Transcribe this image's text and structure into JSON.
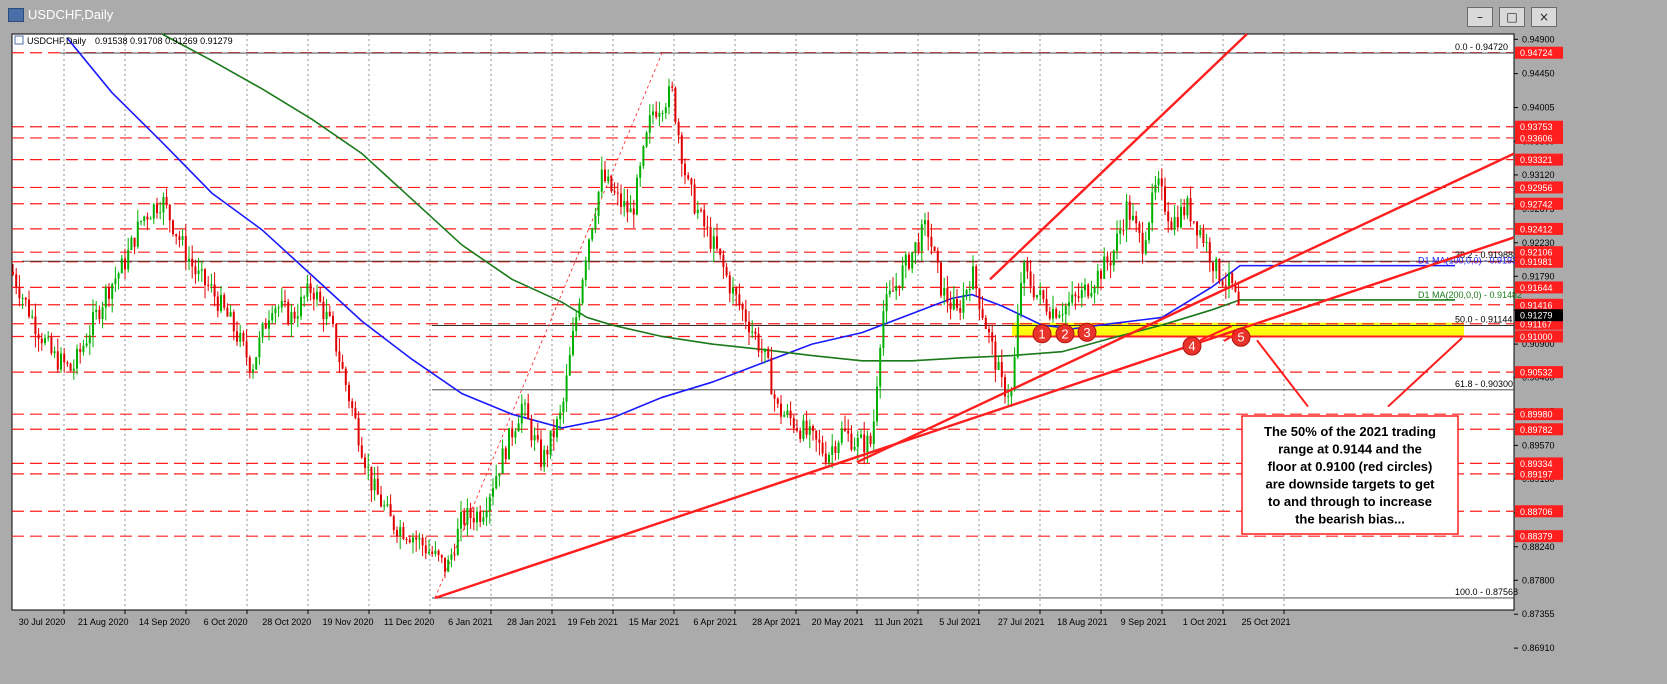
{
  "window": {
    "title": "USDCHF,Daily",
    "min_label": "–",
    "max_label": "□",
    "close_label": "×"
  },
  "chart_data": {
    "type": "candlestick",
    "symbol_label": "USDCHF,Daily",
    "ohlc_label": "0.91538 0.91708 0.91269 0.91279",
    "x_labels": [
      "30 Jul 2020",
      "21 Aug 2020",
      "14 Sep 2020",
      "6 Oct 2020",
      "28 Oct 2020",
      "19 Nov 2020",
      "11 Dec 2020",
      "6 Jan 2021",
      "28 Jan 2021",
      "19 Feb 2021",
      "15 Mar 2021",
      "6 Apr 2021",
      "28 Apr 2021",
      "20 May 2021",
      "11 Jun 2021",
      "5 Jul 2021",
      "27 Jul 2021",
      "18 Aug 2021",
      "9 Sep 2021",
      "1 Oct 2021",
      "25 Oct 2021"
    ],
    "y_ticks": [
      "0.94900",
      "0.94450",
      "0.94005",
      "0.93560",
      "0.93120",
      "0.92675",
      "0.92230",
      "0.91790",
      "0.91345",
      "0.90900",
      "0.90460",
      "0.90015",
      "0.89570",
      "0.89130",
      "0.88685",
      "0.88240",
      "0.87800",
      "0.87355",
      "0.86910"
    ],
    "ylim": [
      0.8741,
      0.9497
    ],
    "current_price": 0.91279,
    "level_tags": [
      {
        "value": 0.94724,
        "label": "0.94724"
      },
      {
        "value": 0.93753,
        "label": "0.93753"
      },
      {
        "value": 0.93606,
        "label": "0.93606"
      },
      {
        "value": 0.93321,
        "label": "0.93321"
      },
      {
        "value": 0.92956,
        "label": "0.92956"
      },
      {
        "value": 0.92742,
        "label": "0.92742"
      },
      {
        "value": 0.92412,
        "label": "0.92412"
      },
      {
        "value": 0.92106,
        "label": "0.92106"
      },
      {
        "value": 0.91981,
        "label": "0.91981"
      },
      {
        "value": 0.91644,
        "label": "0.91644"
      },
      {
        "value": 0.91416,
        "label": "0.91416"
      },
      {
        "value": 0.91167,
        "label": "0.91167"
      },
      {
        "value": 0.91,
        "label": "0.91000"
      },
      {
        "value": 0.90532,
        "label": "0.90532"
      },
      {
        "value": 0.8998,
        "label": "0.89980"
      },
      {
        "value": 0.89782,
        "label": "0.89782"
      },
      {
        "value": 0.89334,
        "label": "0.89334"
      },
      {
        "value": 0.89197,
        "label": "0.89197"
      },
      {
        "value": 0.88706,
        "label": "0.88706"
      },
      {
        "value": 0.88379,
        "label": "0.88379"
      }
    ],
    "fib_levels": [
      {
        "label": "0.0 - 0.94720",
        "value": 0.9472
      },
      {
        "label": "38.2 - 0.91988",
        "value": 0.91988
      },
      {
        "label": "50.0 - 0.91144",
        "value": 0.91144
      },
      {
        "label": "61.8 - 0.90300",
        "value": 0.903
      },
      {
        "label": "100.0 - 0.87568",
        "value": 0.87568
      }
    ],
    "ma_labels": [
      {
        "label": "D1 MA(100,0,0) - 0.91932",
        "value": 0.91932,
        "color": "#1a1aff"
      },
      {
        "label": "D1 MA(200,0,0) - 0.91482",
        "value": 0.91482,
        "color": "#1a7a1a"
      }
    ],
    "circle_labels": [
      "1",
      "2",
      "3",
      "4",
      "5"
    ],
    "annotation": [
      "The 50% of the 2021 trading",
      "range at 0.9144 and the",
      "floor at 0.9100 (red circles)",
      "are downside targets to get",
      "to and through to increase",
      "the bearish bias..."
    ],
    "colors": {
      "up": "#00b000",
      "down": "#e00000",
      "ma100": "#1a1aff",
      "ma200": "#1a7a1a",
      "level": "#ff1e1e",
      "fib": "#222222",
      "zone": "#ffff00",
      "trend": "#ff1e1e"
    },
    "close_path": [
      [
        0,
        0.9185
      ],
      [
        20,
        0.9125
      ],
      [
        40,
        0.9075
      ],
      [
        60,
        0.9055
      ],
      [
        75,
        0.91
      ],
      [
        95,
        0.916
      ],
      [
        112,
        0.9195
      ],
      [
        130,
        0.9255
      ],
      [
        150,
        0.928
      ],
      [
        165,
        0.9235
      ],
      [
        185,
        0.918
      ],
      [
        200,
        0.916
      ],
      [
        220,
        0.9115
      ],
      [
        240,
        0.906
      ],
      [
        260,
        0.9145
      ],
      [
        280,
        0.9125
      ],
      [
        300,
        0.9165
      ],
      [
        320,
        0.911
      ],
      [
        340,
        0.9005
      ],
      [
        360,
        0.8905
      ],
      [
        380,
        0.8855
      ],
      [
        400,
        0.884
      ],
      [
        420,
        0.8815
      ],
      [
        435,
        0.8795
      ],
      [
        450,
        0.886
      ],
      [
        470,
        0.887
      ],
      [
        490,
        0.894
      ],
      [
        510,
        0.901
      ],
      [
        530,
        0.8935
      ],
      [
        550,
        0.9
      ],
      [
        560,
        0.909
      ],
      [
        575,
        0.922
      ],
      [
        590,
        0.931
      ],
      [
        605,
        0.928
      ],
      [
        620,
        0.926
      ],
      [
        640,
        0.9395
      ],
      [
        660,
        0.942
      ],
      [
        675,
        0.93
      ],
      [
        690,
        0.925
      ],
      [
        705,
        0.921
      ],
      [
        720,
        0.916
      ],
      [
        740,
        0.911
      ],
      [
        755,
        0.9065
      ],
      [
        765,
        0.9005
      ],
      [
        780,
        0.899
      ],
      [
        800,
        0.8965
      ],
      [
        815,
        0.8945
      ],
      [
        830,
        0.8975
      ],
      [
        845,
        0.896
      ],
      [
        860,
        0.896
      ],
      [
        870,
        0.913
      ],
      [
        885,
        0.917
      ],
      [
        900,
        0.921
      ],
      [
        915,
        0.9245
      ],
      [
        930,
        0.916
      ],
      [
        945,
        0.913
      ],
      [
        960,
        0.9185
      ],
      [
        975,
        0.911
      ],
      [
        990,
        0.9035
      ],
      [
        1000,
        0.9025
      ],
      [
        1010,
        0.919
      ],
      [
        1025,
        0.9155
      ],
      [
        1040,
        0.9135
      ],
      [
        1055,
        0.914
      ],
      [
        1070,
        0.9155
      ],
      [
        1085,
        0.918
      ],
      [
        1100,
        0.9205
      ],
      [
        1115,
        0.927
      ],
      [
        1130,
        0.922
      ],
      [
        1145,
        0.93
      ],
      [
        1160,
        0.925
      ],
      [
        1175,
        0.927
      ],
      [
        1190,
        0.9235
      ],
      [
        1205,
        0.9185
      ],
      [
        1220,
        0.9165
      ],
      [
        1228,
        0.9128
      ]
    ],
    "ma100_path": [
      [
        55,
        0.9492
      ],
      [
        100,
        0.942
      ],
      [
        150,
        0.9355
      ],
      [
        200,
        0.9288
      ],
      [
        250,
        0.924
      ],
      [
        300,
        0.918
      ],
      [
        350,
        0.912
      ],
      [
        400,
        0.907
      ],
      [
        450,
        0.9025
      ],
      [
        500,
        0.8998
      ],
      [
        550,
        0.898
      ],
      [
        600,
        0.8993
      ],
      [
        650,
        0.902
      ],
      [
        700,
        0.904
      ],
      [
        750,
        0.9065
      ],
      [
        800,
        0.909
      ],
      [
        850,
        0.9105
      ],
      [
        900,
        0.913
      ],
      [
        940,
        0.915
      ],
      [
        960,
        0.9155
      ],
      [
        990,
        0.914
      ],
      [
        1030,
        0.9115
      ],
      [
        1060,
        0.911
      ],
      [
        1100,
        0.9117
      ],
      [
        1150,
        0.9125
      ],
      [
        1200,
        0.9165
      ],
      [
        1228,
        0.9193
      ],
      [
        1443,
        0.9193
      ]
    ],
    "ma200_path": [
      [
        150,
        0.9497
      ],
      [
        200,
        0.9462
      ],
      [
        250,
        0.9425
      ],
      [
        300,
        0.9385
      ],
      [
        350,
        0.934
      ],
      [
        400,
        0.928
      ],
      [
        450,
        0.922
      ],
      [
        500,
        0.9175
      ],
      [
        550,
        0.9145
      ],
      [
        575,
        0.9125
      ],
      [
        600,
        0.9115
      ],
      [
        650,
        0.91
      ],
      [
        700,
        0.909
      ],
      [
        750,
        0.9083
      ],
      [
        800,
        0.9075
      ],
      [
        850,
        0.9068
      ],
      [
        900,
        0.9068
      ],
      [
        950,
        0.9072
      ],
      [
        1000,
        0.9075
      ],
      [
        1050,
        0.908
      ],
      [
        1100,
        0.9098
      ],
      [
        1150,
        0.9115
      ],
      [
        1200,
        0.9135
      ],
      [
        1228,
        0.9148
      ],
      [
        1443,
        0.9148
      ]
    ]
  }
}
